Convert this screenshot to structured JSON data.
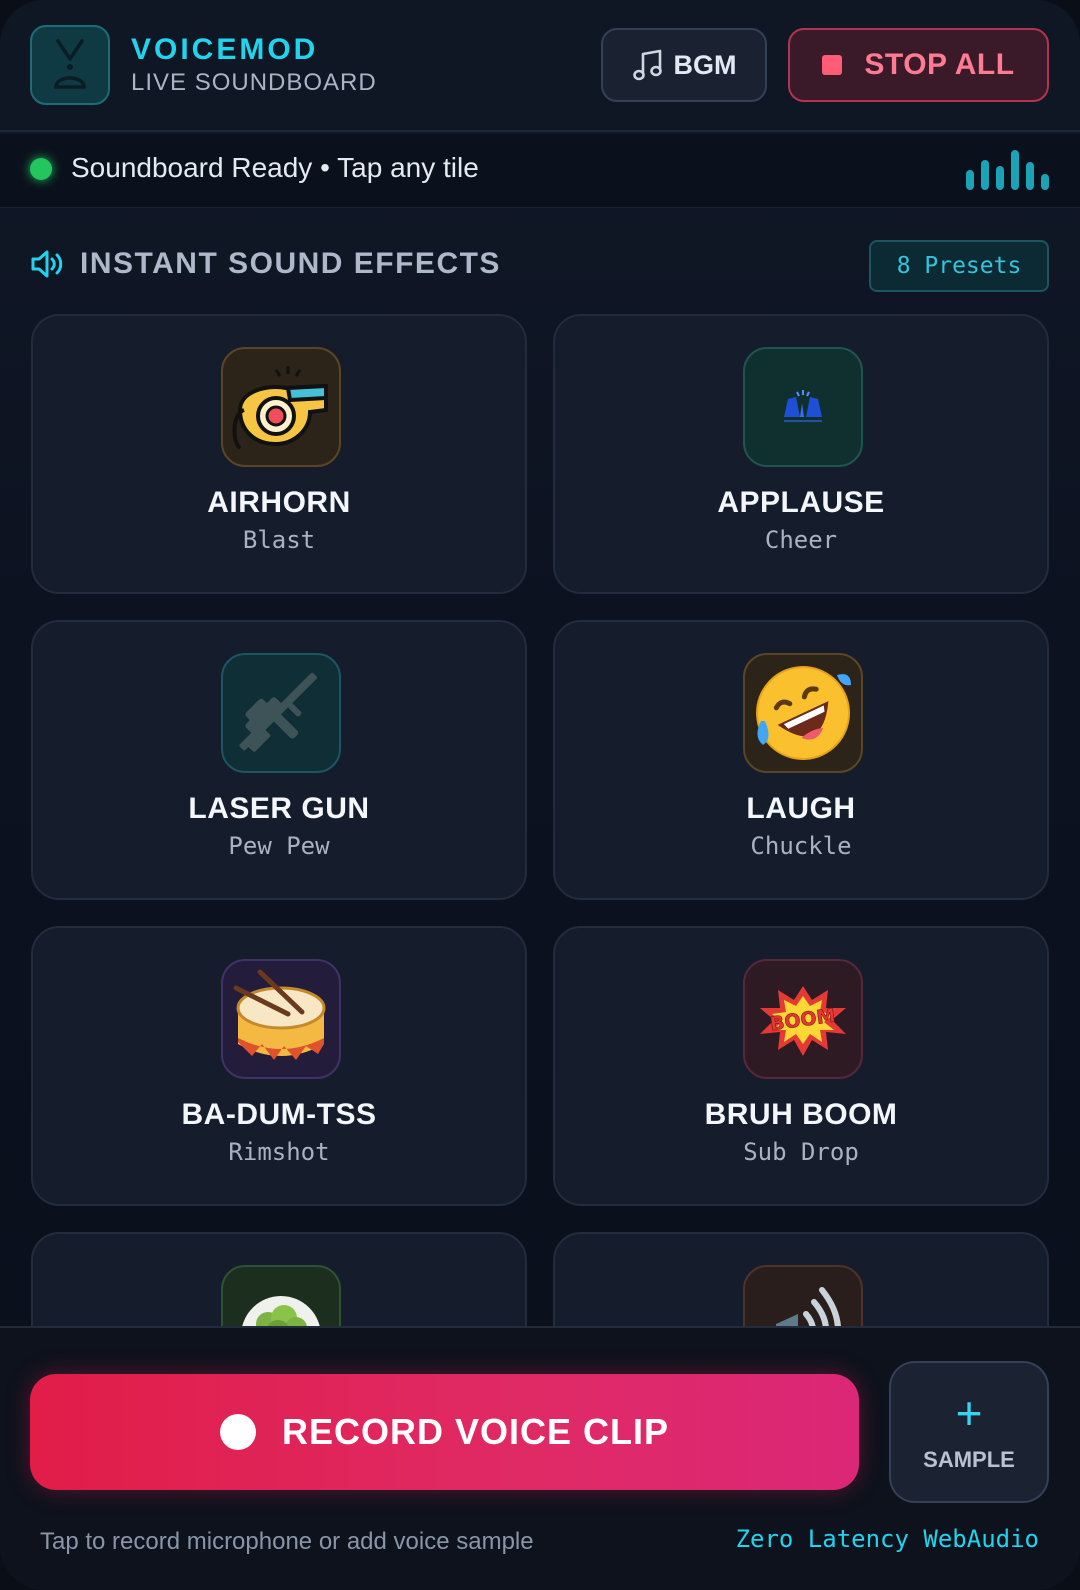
{
  "header": {
    "brand_name": "VOICEMOD",
    "brand_sub": "LIVE SOUNDBOARD",
    "bgm_label": "BGM",
    "stop_label": "STOP ALL",
    "accent": "#22d3ee"
  },
  "status": {
    "text": "Soundboard Ready • Tap any tile",
    "indicator_color": "#22c55e"
  },
  "section": {
    "title": "INSTANT SOUND EFFECTS",
    "presets_label": "8 Presets"
  },
  "tiles": [
    {
      "title": "AIRHORN",
      "sub": "Blast",
      "icon": "whistle-icon"
    },
    {
      "title": "APPLAUSE",
      "sub": "Cheer",
      "icon": "clapping-hands-icon"
    },
    {
      "title": "LASER GUN",
      "sub": "Pew Pew",
      "icon": "rifle-icon"
    },
    {
      "title": "LAUGH",
      "sub": "Chuckle",
      "icon": "rolling-laughing-face-icon"
    },
    {
      "title": "BA-DUM-TSS",
      "sub": "Rimshot",
      "icon": "drum-icon"
    },
    {
      "title": "BRUH BOOM",
      "sub": "Sub Drop",
      "icon": "boom-icon"
    },
    {
      "title": "",
      "sub": "",
      "icon": "broccoli-plate-icon"
    },
    {
      "title": "",
      "sub": "",
      "icon": "speaker-waves-icon"
    }
  ],
  "dock": {
    "record_label": "RECORD VOICE CLIP",
    "sample_label": "SAMPLE",
    "sample_symbol": "+",
    "hint": "Tap to record microphone or add voice sample",
    "latency": "Zero Latency WebAudio",
    "record_color": "#e11d48"
  }
}
